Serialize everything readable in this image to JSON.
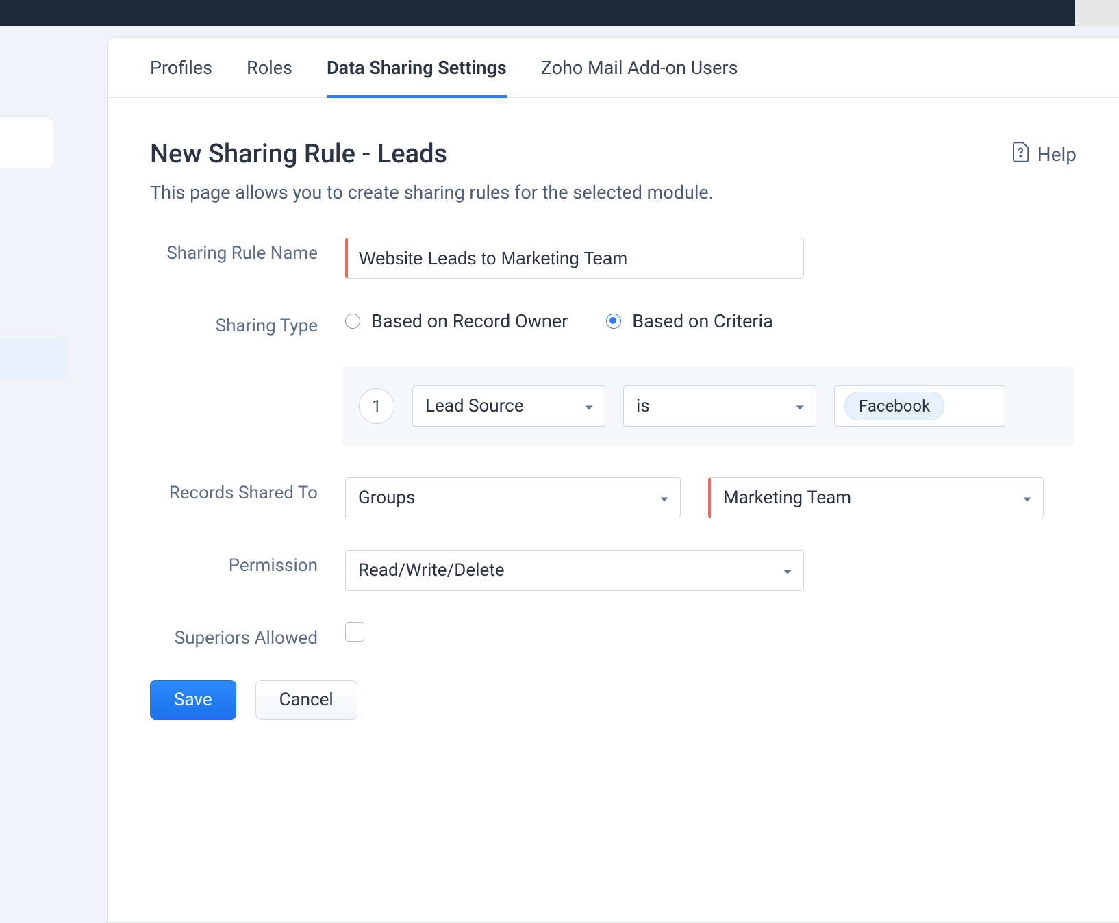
{
  "tabs": {
    "profiles": "Profiles",
    "roles": "Roles",
    "data_sharing": "Data Sharing Settings",
    "mail_addon": "Zoho Mail Add-on Users"
  },
  "header": {
    "title": "New Sharing Rule - Leads",
    "help_label": "Help",
    "subtitle": "This page allows you to create sharing rules for the selected module."
  },
  "labels": {
    "rule_name": "Sharing Rule Name",
    "sharing_type": "Sharing Type",
    "records_shared_to": "Records Shared To",
    "permission": "Permission",
    "superiors_allowed": "Superiors Allowed"
  },
  "fields": {
    "rule_name_value": "Website Leads to Marketing Team",
    "sharing_type_options": {
      "owner": "Based on Record Owner",
      "criteria": "Based on Criteria"
    },
    "sharing_type_selected": "criteria",
    "criteria": {
      "index": "1",
      "field": "Lead Source",
      "operator": "is",
      "value": "Facebook"
    },
    "records_shared_to": {
      "type": "Groups",
      "target": "Marketing Team"
    },
    "permission_value": "Read/Write/Delete",
    "superiors_allowed_checked": false
  },
  "buttons": {
    "save": "Save",
    "cancel": "Cancel"
  }
}
